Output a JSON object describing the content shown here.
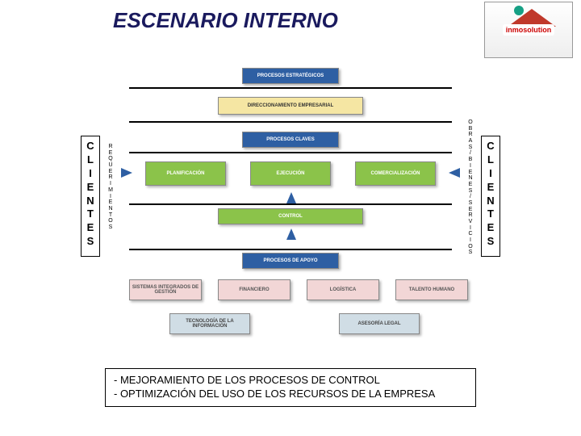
{
  "title": "ESCENARIO INTERNO",
  "logo_text": "inmosolution",
  "side": {
    "clientes": "CLIENTES",
    "requerimientos": "REQUERIMIENTOS",
    "obras": "OBRAS / BIENES / SERVICIOS"
  },
  "headers": {
    "estrategicos": "PROCESOS ESTRATÉGICOS",
    "claves": "PROCESOS CLAVES",
    "apoyo": "PROCESOS DE APOYO"
  },
  "boxes": {
    "direccionamiento": "DIRECCIONAMIENTO EMPRESARIAL",
    "planificacion": "PLANIFICACIÓN",
    "ejecucion": "EJECUCIÓN",
    "comercializacion": "COMERCIALIZACIÓN",
    "control": "CONTROL",
    "sig": "SISTEMAS INTEGRADOS DE GESTIÓN",
    "financiero": "FINANCIERO",
    "logistica": "LOGÍSTICA",
    "talento": "TALENTO HUMANO",
    "tecnologia": "TECNOLOGÍA DE LA INFORMACIÓN",
    "asesoria": "ASESORÍA LEGAL"
  },
  "footer": {
    "line1": "- MEJORAMIENTO DE LOS PROCESOS DE CONTROL",
    "line2": "- OPTIMIZACIÓN DEL USO DE LOS RECURSOS DE LA EMPRESA"
  }
}
